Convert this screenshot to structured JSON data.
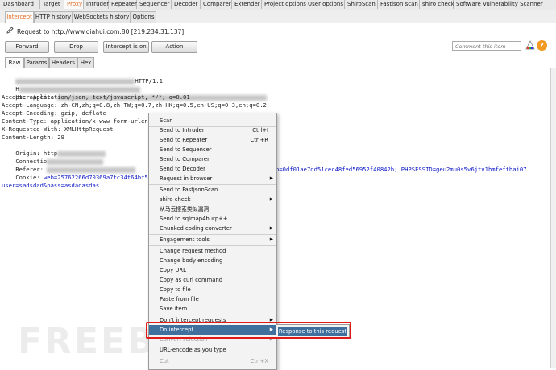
{
  "top_tabs": [
    {
      "label": "Dashboard",
      "active": false
    },
    {
      "label": "Target",
      "active": false
    },
    {
      "label": "Proxy",
      "active": true
    },
    {
      "label": "Intruder",
      "active": false
    },
    {
      "label": "Repeater",
      "active": false
    },
    {
      "label": "Sequencer",
      "active": false
    },
    {
      "label": "Decoder",
      "active": false
    },
    {
      "label": "Comparer",
      "active": false
    },
    {
      "label": "Extender",
      "active": false
    },
    {
      "label": "Project options",
      "active": false
    },
    {
      "label": "User options",
      "active": false
    },
    {
      "label": "ShiroScan",
      "active": false
    },
    {
      "label": "Fastjson scan",
      "active": false
    },
    {
      "label": "shiro check",
      "active": false
    },
    {
      "label": "Software Vulnerability Scanner",
      "active": false
    }
  ],
  "sub_tabs": [
    {
      "label": "Intercept",
      "active": true
    },
    {
      "label": "HTTP history",
      "active": false
    },
    {
      "label": "WebSockets history",
      "active": false
    },
    {
      "label": "Options",
      "active": false
    }
  ],
  "request_info": "Request to http://www.qiahui.com:80  [219.234.31.137]",
  "buttons": {
    "forward": "Forward",
    "drop": "Drop",
    "intercept": "Intercept is on",
    "action": "Action"
  },
  "comment_placeholder": "Comment this item",
  "message_tabs": [
    "Raw",
    "Params",
    "Headers",
    "Hex"
  ],
  "request_lines": [
    {
      "text": "HTTP/1.1",
      "blur_before": true
    },
    {
      "text": "H",
      "blur_after": true
    },
    {
      "text": "User-Agent: ",
      "blur_after": true
    },
    {
      "text": "Accept: application/json, text/javascript, */*; q=0.01"
    },
    {
      "text": "Accept-Language: zh-CN,zh;q=0.8,zh-TW;q=0.7,zh-HK;q=0.5,en-US;q=0.3,en;q=0.2"
    },
    {
      "text": "Accept-Encoding: gzip, deflate"
    },
    {
      "text": "Content-Type: application/x-www-form-urlenc"
    },
    {
      "text": "X-Requested-With: XMLHttpRequest"
    },
    {
      "text": "Content-Length: 29"
    },
    {
      "text": "Origin: http",
      "blur_after": true
    },
    {
      "text": "Connectio",
      "blur_after": true
    },
    {
      "text": "Referer: ",
      "blur_after": true
    }
  ],
  "cookie_line": {
    "prefix": "Cookie: ",
    "value_left": "web=25762266d70369a7fc34f64bf5b9e60",
    "value_right": "o=0df01ae7dd51cec48fed56952f40842b; PHPSESSID=geu2mu0s5v6jtv1hmfefthai07"
  },
  "body_line": "user=sadsdad&pass=asdadasdas",
  "context_menu": {
    "items": [
      {
        "label": "Scan"
      },
      {
        "label": "Send to Intruder",
        "shortcut": "Ctrl+I"
      },
      {
        "label": "Send to Repeater",
        "shortcut": "Ctrl+R"
      },
      {
        "label": "Send to Sequencer"
      },
      {
        "label": "Send to Comparer"
      },
      {
        "label": "Send to Decoder"
      },
      {
        "label": "Request in browser",
        "submenu": true
      },
      {
        "label": "Send to FastjsonScan"
      },
      {
        "label": "shiro check",
        "submenu": true
      },
      {
        "label": "从马云搜索类似漏洞"
      },
      {
        "label": "Send to sqlmap4burp++"
      },
      {
        "label": "Chunked coding converter",
        "submenu": true
      },
      {
        "label": "Engagement tools",
        "submenu": true
      },
      {
        "label": "Change request method"
      },
      {
        "label": "Change body encoding"
      },
      {
        "label": "Copy URL"
      },
      {
        "label": "Copy as curl command"
      },
      {
        "label": "Copy to file"
      },
      {
        "label": "Paste from file"
      },
      {
        "label": "Save item"
      },
      {
        "label": "Don't intercept requests",
        "submenu": true
      },
      {
        "label": "Do intercept",
        "submenu": true,
        "highlighted": true
      },
      {
        "label": "Convert selection",
        "submenu": true,
        "disabled": true
      },
      {
        "label": "URL-encode as you type"
      },
      {
        "label": "Cut",
        "shortcut": "Ctrl+X",
        "disabled": true
      }
    ],
    "submenu_item": "Response to this request"
  },
  "watermark": "FREEBU",
  "colors": {
    "active_tab_text": "#e46a21",
    "menu_highlight": "#3f6f9d",
    "red_outline": "#e01919",
    "cookie_value": "#0b16c6"
  }
}
